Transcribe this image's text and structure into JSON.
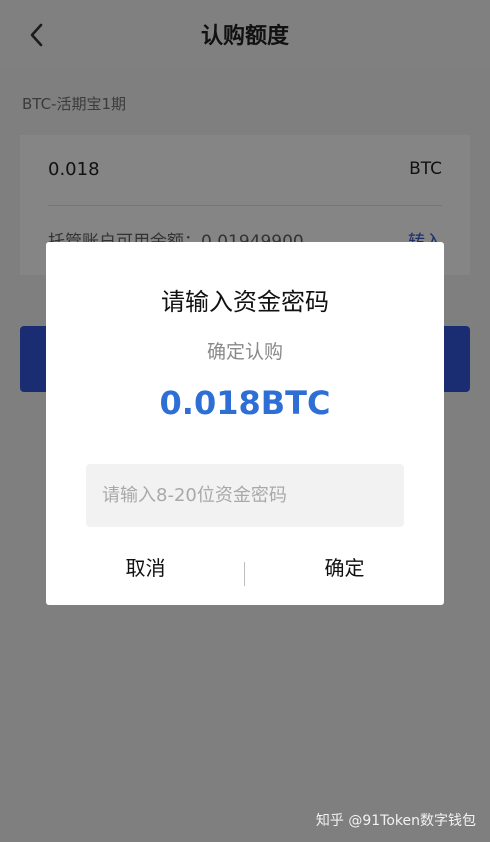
{
  "header": {
    "title": "认购额度",
    "back_icon": "chevron-left-icon"
  },
  "product": {
    "name": "BTC-活期宝1期"
  },
  "form": {
    "amount": "0.018",
    "unit": "BTC",
    "balance_label": "托管账户可用余额：0.01949900",
    "transfer_label": "转入"
  },
  "dialog": {
    "title": "请输入资金密码",
    "subtitle": "确定认购",
    "amount": "0.018BTC",
    "password_placeholder": "请输入8-20位资金密码",
    "password_value": "",
    "cancel_label": "取消",
    "confirm_label": "确定"
  },
  "watermark": "知乎 @91Token数字钱包",
  "colors": {
    "accent": "#2e6fd6",
    "overlay": "#7f7f7f",
    "primary_button": "#1a2d72"
  }
}
